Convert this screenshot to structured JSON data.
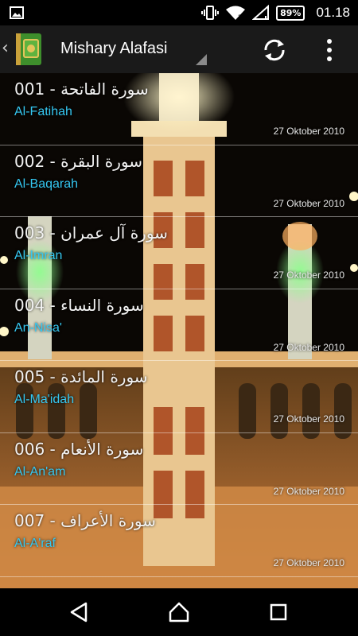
{
  "status_bar": {
    "battery": "89%",
    "time": "01.18",
    "icons": [
      "image-icon",
      "vibrate-icon",
      "wifi-icon",
      "signal-icon",
      "battery-icon"
    ]
  },
  "action_bar": {
    "title": "Mishary Alafasi",
    "icons": [
      "back-arrow-icon",
      "quran-book-icon",
      "dropdown-icon",
      "refresh-icon",
      "overflow-menu-icon"
    ]
  },
  "surah_list": [
    {
      "arabic": "سورة الفاتحة - 001",
      "latin": "Al-Fatihah",
      "date": "27 Oktober 2010"
    },
    {
      "arabic": "سورة البقرة - 002",
      "latin": "Al-Baqarah",
      "date": "27 Oktober 2010"
    },
    {
      "arabic": "سورة آل عمران - 003",
      "latin": "Al-Imran",
      "date": "27 Oktober 2010"
    },
    {
      "arabic": "سورة النساء - 004",
      "latin": "An-Nisa'",
      "date": "27 Oktober 2010"
    },
    {
      "arabic": "سورة المائدة - 005",
      "latin": "Al-Ma'idah",
      "date": "27 Oktober 2010"
    },
    {
      "arabic": "سورة الأنعام - 006",
      "latin": "Al-An'am",
      "date": "27 Oktober 2010"
    },
    {
      "arabic": "سورة الأعراف - 007",
      "latin": "Al-A'raf",
      "date": "27 Oktober 2010"
    }
  ],
  "nav_bar": {
    "icons": [
      "back-icon",
      "home-icon",
      "recents-icon"
    ]
  },
  "colors": {
    "accent": "#35c8f2",
    "action_bar": "#1a1a1a"
  }
}
